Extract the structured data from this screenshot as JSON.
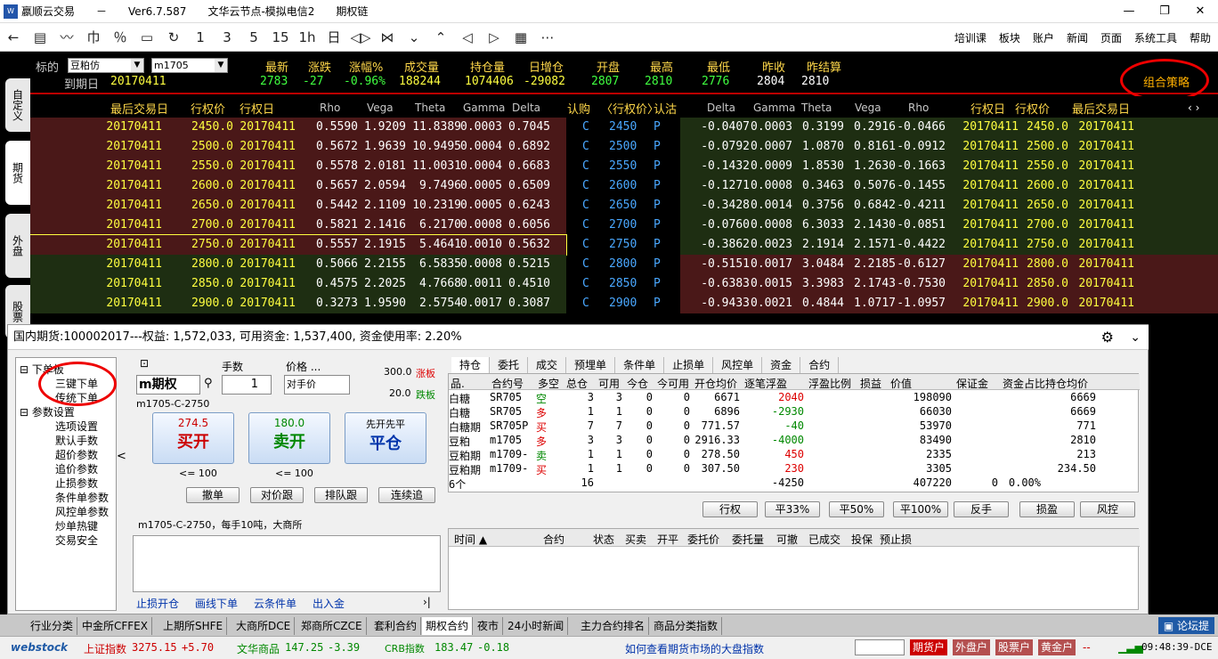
{
  "window": {
    "title_parts": [
      "嬴顺云交易",
      "－",
      "Ver6.7.587",
      "文华云节点-模拟电信2",
      "期权链"
    ],
    "controls": [
      "—",
      "❐",
      "✕"
    ]
  },
  "toolbar": {
    "icons": [
      "←",
      "▤",
      "〰",
      "巾",
      "％",
      "▭",
      "↻",
      "1",
      "3",
      "5",
      "15",
      "1h",
      "日",
      "◁▷",
      "⋈",
      "⌄",
      "⌃",
      "◁",
      "▷",
      "▦",
      "⋯"
    ],
    "menus": [
      "培训课",
      "板块",
      "账户",
      "新闻",
      "页面",
      "系统工具",
      "帮助"
    ]
  },
  "left_tabs": [
    "自定义",
    "期货",
    "外盘",
    "股票"
  ],
  "quote": {
    "label_biaodi": "标的",
    "product": "豆粕仿",
    "contract": "m1705",
    "label_expiry": "到期日",
    "expiry": "20170411",
    "headers": [
      "最新",
      "涨跌",
      "涨幅%",
      "成交量",
      "持仓量",
      "日增仓",
      "开盘",
      "最高",
      "最低",
      "昨收",
      "昨结算"
    ],
    "values": [
      "2783",
      "-27",
      "-0.96%",
      "188244",
      "1074406",
      "-29082",
      "2807",
      "2810",
      "2776",
      "2804",
      "2810"
    ],
    "combo_strategy": "组合策略"
  },
  "chain": {
    "headers_left": [
      "最后交易日",
      "行权价",
      "行权日",
      "Rho",
      "Vega",
      "Theta",
      "Gamma",
      "Delta"
    ],
    "headers_mid": [
      "认购",
      "〈行权价〉",
      "认沽"
    ],
    "headers_right": [
      "Delta",
      "Gamma",
      "Theta",
      "Vega",
      "Rho",
      "行权日",
      "行权价",
      "最后交易日"
    ],
    "nav": "‹ ›",
    "rows": [
      [
        "20170411",
        "2450.0",
        "20170411",
        "0.5590",
        "1.9209",
        "11.8389",
        "0.0003",
        "0.7045",
        "C",
        "2450",
        "P",
        "-0.0407",
        "0.0003",
        "0.3199",
        "0.2916",
        "-0.0466",
        "20170411",
        "2450.0",
        "20170411"
      ],
      [
        "20170411",
        "2500.0",
        "20170411",
        "0.5672",
        "1.9639",
        "10.9495",
        "0.0004",
        "0.6892",
        "C",
        "2500",
        "P",
        "-0.0792",
        "0.0007",
        "1.0870",
        "0.8161",
        "-0.0912",
        "20170411",
        "2500.0",
        "20170411"
      ],
      [
        "20170411",
        "2550.0",
        "20170411",
        "0.5578",
        "2.0181",
        "11.0031",
        "0.0004",
        "0.6683",
        "C",
        "2550",
        "P",
        "-0.1432",
        "0.0009",
        "1.8530",
        "1.2630",
        "-0.1663",
        "20170411",
        "2550.0",
        "20170411"
      ],
      [
        "20170411",
        "2600.0",
        "20170411",
        "0.5657",
        "2.0594",
        "9.7496",
        "0.0005",
        "0.6509",
        "C",
        "2600",
        "P",
        "-0.1271",
        "0.0008",
        "0.3463",
        "0.5076",
        "-0.1455",
        "20170411",
        "2600.0",
        "20170411"
      ],
      [
        "20170411",
        "2650.0",
        "20170411",
        "0.5442",
        "2.1109",
        "10.2319",
        "0.0005",
        "0.6243",
        "C",
        "2650",
        "P",
        "-0.3428",
        "0.0014",
        "0.3756",
        "0.6842",
        "-0.4211",
        "20170411",
        "2650.0",
        "20170411"
      ],
      [
        "20170411",
        "2700.0",
        "20170411",
        "0.5821",
        "2.1416",
        "6.2170",
        "0.0008",
        "0.6056",
        "C",
        "2700",
        "P",
        "-0.0760",
        "0.0008",
        "6.3033",
        "2.1430",
        "-0.0851",
        "20170411",
        "2700.0",
        "20170411"
      ],
      [
        "20170411",
        "2750.0",
        "20170411",
        "0.5557",
        "2.1915",
        "5.4641",
        "0.0010",
        "0.5632",
        "C",
        "2750",
        "P",
        "-0.3862",
        "0.0023",
        "2.1914",
        "2.1571",
        "-0.4422",
        "20170411",
        "2750.0",
        "20170411"
      ],
      [
        "20170411",
        "2800.0",
        "20170411",
        "0.5066",
        "2.2155",
        "6.5835",
        "0.0008",
        "0.5215",
        "C",
        "2800",
        "P",
        "-0.5151",
        "0.0017",
        "3.0484",
        "2.2185",
        "-0.6127",
        "20170411",
        "2800.0",
        "20170411"
      ],
      [
        "20170411",
        "2850.0",
        "20170411",
        "0.4575",
        "2.2025",
        "4.7668",
        "0.0011",
        "0.4510",
        "C",
        "2850",
        "P",
        "-0.6383",
        "0.0015",
        "3.3983",
        "2.1743",
        "-0.7530",
        "20170411",
        "2850.0",
        "20170411"
      ],
      [
        "20170411",
        "2900.0",
        "20170411",
        "0.3273",
        "1.9590",
        "2.5754",
        "0.0017",
        "0.3087",
        "C",
        "2900",
        "P",
        "-0.9433",
        "0.0021",
        "0.4844",
        "1.0717",
        "-1.0957",
        "20170411",
        "2900.0",
        "20170411"
      ]
    ]
  },
  "panel": {
    "title": "国内期货:100002017---权益: 1,572,033, 可用资金: 1,537,400, 资金使用率: 2.20%",
    "tree": [
      [
        "⊟ 下单板",
        0
      ],
      [
        "三键下单",
        1
      ],
      [
        "传统下单",
        1
      ],
      [
        "⊟ 参数设置",
        0
      ],
      [
        "选项设置",
        1
      ],
      [
        "默认手数",
        1
      ],
      [
        "超价参数",
        1
      ],
      [
        "追价参数",
        1
      ],
      [
        "止损参数",
        1
      ],
      [
        "条件单参数",
        1
      ],
      [
        "风控单参数",
        1
      ],
      [
        "炒单热键",
        1
      ],
      [
        "交易安全",
        1
      ]
    ],
    "order": {
      "lots_label": "手数",
      "price_label": "价格 ...",
      "product": "m期权",
      "lots": "1",
      "price_mode": "对手价",
      "limit_up": "300.0",
      "limit_up_label": "涨板",
      "limit_down": "20.0",
      "limit_down_label": "跌板",
      "contract": "m1705-C-2750",
      "buy_price": "274.5",
      "buy_label": "买开",
      "sell_price": "180.0",
      "sell_label": "卖开",
      "close_top": "先开先平",
      "close_label": "平仓",
      "buy_max": "<= 100",
      "sell_max": "<= 100",
      "btns": [
        "撤单",
        "对价跟",
        "排队跟",
        "连续追"
      ],
      "info": "m1705-C-2750，每手10吨，大商所",
      "links": [
        "止损开仓",
        "画线下单",
        "云条件单",
        "出入金"
      ],
      "nav": "›|",
      "collapse": "<"
    },
    "tabs": [
      "持仓",
      "委托",
      "成交",
      "预埋单",
      "条件单",
      "止损单",
      "风控单",
      "资金",
      "合约"
    ],
    "pos_headers": [
      "品.",
      "合约号",
      "多空",
      "总仓",
      "可用",
      "今仓",
      "今可用",
      "开仓均价",
      "逐笔浮盈",
      "浮盈比例",
      "损益",
      "价值",
      "保证金",
      "资金占比",
      "持仓均价"
    ],
    "positions": [
      [
        "白糖",
        "SR705",
        "空",
        "3",
        "3",
        "0",
        "0",
        "6671",
        "2040",
        "",
        "",
        "198090",
        "",
        "",
        "6669"
      ],
      [
        "白糖",
        "SR705",
        "多",
        "1",
        "1",
        "0",
        "0",
        "6896",
        "-2930",
        "",
        "",
        "66030",
        "",
        "",
        "6669"
      ],
      [
        "白糖期",
        "SR705P",
        "买",
        "7",
        "7",
        "0",
        "0",
        "771.57",
        "-40",
        "",
        "",
        "53970",
        "",
        "",
        "771"
      ],
      [
        "豆粕",
        "m1705",
        "多",
        "3",
        "3",
        "0",
        "0",
        "2916.33",
        "-4000",
        "",
        "",
        "83490",
        "",
        "",
        "2810"
      ],
      [
        "豆粕期",
        "m1709-",
        "卖",
        "1",
        "1",
        "0",
        "0",
        "278.50",
        "450",
        "",
        "",
        "2335",
        "",
        "",
        "213"
      ],
      [
        "豆粕期",
        "m1709-",
        "买",
        "1",
        "1",
        "0",
        "0",
        "307.50",
        "230",
        "",
        "",
        "3305",
        "",
        "",
        "234.50"
      ]
    ],
    "pos_total": [
      "6个",
      "16",
      "-4250",
      "407220",
      "0",
      "0.00%"
    ],
    "action_btns": [
      "行权",
      "平33%",
      "平50%",
      "平100%",
      "反手",
      "损盈",
      "风控"
    ],
    "order_headers": [
      "时间 ▲",
      "合约",
      "状态",
      "买卖",
      "开平",
      "委托价",
      "委托量",
      "可撤",
      "已成交",
      "投保",
      "预止损"
    ]
  },
  "bottom_tabs": [
    "行业分类",
    "中金所CFFEX",
    "上期所SHFE",
    "大商所DCE",
    "郑商所CZCE",
    "套利合约",
    "期权合约",
    "夜市",
    "24小时新闻",
    "主力合约排名",
    "商品分类指数"
  ],
  "forum": "论坛提",
  "status": {
    "brand": "webstock",
    "i1_label": "上证指数",
    "i1_val": "3275.15",
    "i1_chg": "+5.70",
    "i2_label": "文华商品",
    "i2_val": "147.25",
    "i2_chg": "-3.39",
    "i3_label": "CRB指数",
    "i3_val": "183.47",
    "i3_chg": "-0.18",
    "news": "如何查看期货市场的大盘指数",
    "accounts": [
      "期货户",
      "外盘户",
      "股票户",
      "黄金户"
    ],
    "dash": "--",
    "time": "09:48:39-DCE"
  }
}
